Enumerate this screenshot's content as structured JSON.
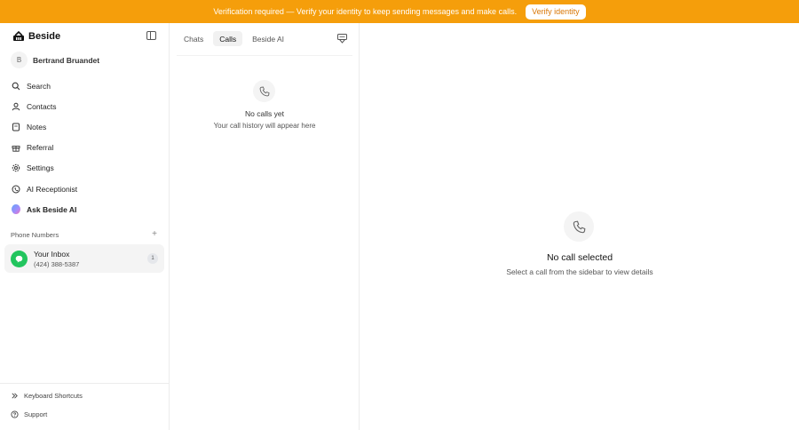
{
  "banner": {
    "message": "Verification required — Verify your identity to keep sending messages and make calls.",
    "button_label": "Verify identity",
    "color": "#f59e0b"
  },
  "sidebar": {
    "brand": "Beside",
    "user": {
      "initial": "B",
      "name": "Bertrand Bruandet"
    },
    "nav": [
      {
        "label": "Search",
        "icon": "search-icon"
      },
      {
        "label": "Contacts",
        "icon": "contacts-icon"
      },
      {
        "label": "Notes",
        "icon": "notes-icon"
      },
      {
        "label": "Referral",
        "icon": "gift-icon"
      },
      {
        "label": "Settings",
        "icon": "gear-icon"
      },
      {
        "label": "AI Receptionist",
        "icon": "receptionist-icon"
      },
      {
        "label": "Ask Beside AI",
        "icon": "beside-ai-orb-icon"
      }
    ],
    "section_title": "Phone Numbers",
    "inbox": {
      "name": "Your Inbox",
      "phone": "(424) 388-5387",
      "badge": "1"
    },
    "footer": {
      "shortcuts": "Keyboard Shortcuts",
      "support": "Support"
    }
  },
  "calls_pane": {
    "tabs": [
      "Chats",
      "Calls",
      "Beside AI"
    ],
    "active_tab": "Calls",
    "empty_title": "No calls yet",
    "empty_subtitle": "Your call history will appear here"
  },
  "detail": {
    "empty_title": "No call selected",
    "empty_subtitle": "Select a call from the sidebar to view details"
  }
}
